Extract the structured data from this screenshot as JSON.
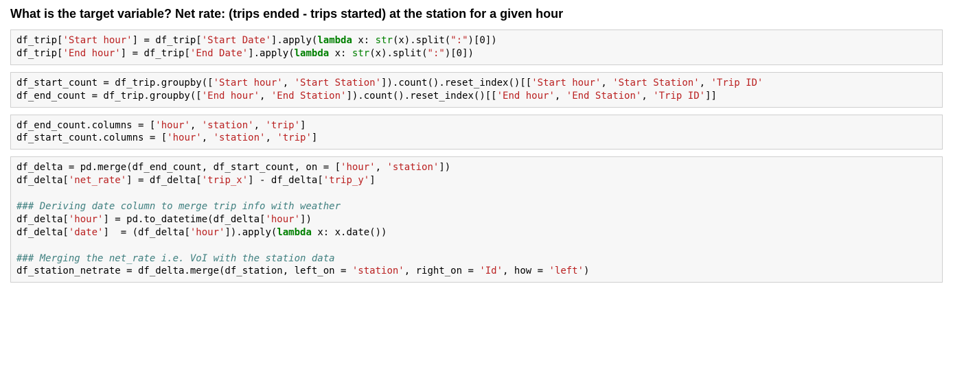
{
  "heading": "What is the target variable? Net rate: (trips ended - trips started) at the station for a given hour",
  "cells": {
    "c1": {
      "l1a": "df_trip[",
      "l1b": "'Start hour'",
      "l1c": "] = df_trip[",
      "l1d": "'Start Date'",
      "l1e": "].apply(",
      "l1f": "lambda",
      "l1g": " x: ",
      "l1h": "str",
      "l1i": "(x).split(",
      "l1j": "\":\"",
      "l1k": ")[",
      "l1l": "0",
      "l1m": "])",
      "l2a": "df_trip[",
      "l2b": "'End hour'",
      "l2c": "] = df_trip[",
      "l2d": "'End Date'",
      "l2e": "].apply(",
      "l2f": "lambda",
      "l2g": " x: ",
      "l2h": "str",
      "l2i": "(x).split(",
      "l2j": "\":\"",
      "l2k": ")[",
      "l2l": "0",
      "l2m": "])"
    },
    "c2": {
      "l1a": "df_start_count = df_trip.groupby([",
      "l1b": "'Start hour'",
      "l1c": ", ",
      "l1d": "'Start Station'",
      "l1e": "]).count().reset_index()[[",
      "l1f": "'Start hour'",
      "l1g": ", ",
      "l1h": "'Start Station'",
      "l1i": ", ",
      "l1j": "'Trip ID'",
      "l2a": "df_end_count = df_trip.groupby([",
      "l2b": "'End hour'",
      "l2c": ", ",
      "l2d": "'End Station'",
      "l2e": "]).count().reset_index()[[",
      "l2f": "'End hour'",
      "l2g": ", ",
      "l2h": "'End Station'",
      "l2i": ", ",
      "l2j": "'Trip ID'",
      "l2k": "]]"
    },
    "c3": {
      "l1a": "df_end_count.columns = [",
      "l1b": "'hour'",
      "l1c": ", ",
      "l1d": "'station'",
      "l1e": ", ",
      "l1f": "'trip'",
      "l1g": "]",
      "l2a": "df_start_count.columns = [",
      "l2b": "'hour'",
      "l2c": ", ",
      "l2d": "'station'",
      "l2e": ", ",
      "l2f": "'trip'",
      "l2g": "]"
    },
    "c4": {
      "l1a": "df_delta = pd.merge(df_end_count, df_start_count, on = [",
      "l1b": "'hour'",
      "l1c": ", ",
      "l1d": "'station'",
      "l1e": "])",
      "l2a": "df_delta[",
      "l2b": "'net_rate'",
      "l2c": "] = df_delta[",
      "l2d": "'trip_x'",
      "l2e": "] - df_delta[",
      "l2f": "'trip_y'",
      "l2g": "]",
      "l3": "### Deriving date column to merge trip info with weather",
      "l4a": "df_delta[",
      "l4b": "'hour'",
      "l4c": "] = pd.to_datetime(df_delta[",
      "l4d": "'hour'",
      "l4e": "])",
      "l5a": "df_delta[",
      "l5b": "'date'",
      "l5c": "]  = (df_delta[",
      "l5d": "'hour'",
      "l5e": "]).apply(",
      "l5f": "lambda",
      "l5g": " x: x.date())",
      "l6": "### Merging the net_rate i.e. VoI with the station data",
      "l7a": "df_station_netrate = df_delta.merge(df_station, left_on = ",
      "l7b": "'station'",
      "l7c": ", right_on = ",
      "l7d": "'Id'",
      "l7e": ", how = ",
      "l7f": "'left'",
      "l7g": ")"
    }
  }
}
